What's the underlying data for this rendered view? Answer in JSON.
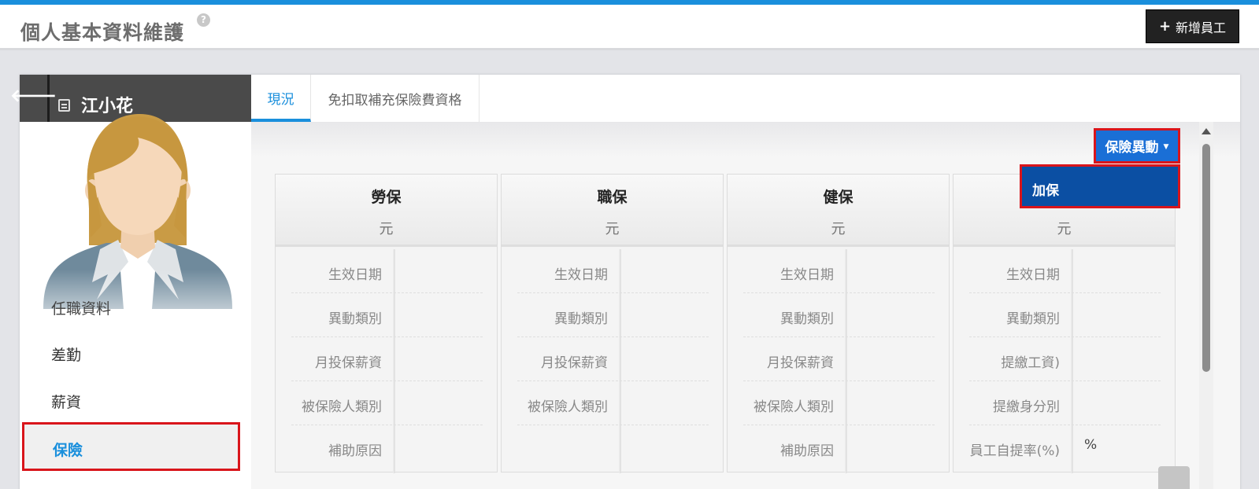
{
  "header": {
    "title": "個人基本資料維護",
    "help": "?",
    "add_button_plus": "+",
    "add_button_label": "新增員工"
  },
  "employee": {
    "name": "江小花"
  },
  "sidebar": {
    "items": [
      {
        "label": "任職資料"
      },
      {
        "label": "差勤"
      },
      {
        "label": "薪資"
      },
      {
        "label": "保險"
      }
    ]
  },
  "tabs": [
    {
      "label": "現況",
      "active": true
    },
    {
      "label": "免扣取補充保險費資格",
      "active": false
    }
  ],
  "actions": {
    "insurance_change_label": "保險異動",
    "menu_items": [
      {
        "label": "加保"
      }
    ]
  },
  "cards": [
    {
      "title": "勞保",
      "unit": "元",
      "rows": [
        {
          "label": "生效日期",
          "value": ""
        },
        {
          "label": "異動類別",
          "value": ""
        },
        {
          "label": "月投保薪資",
          "value": ""
        },
        {
          "label": "被保險人類別",
          "value": ""
        },
        {
          "label": "補助原因",
          "value": ""
        }
      ]
    },
    {
      "title": "職保",
      "unit": "元",
      "rows": [
        {
          "label": "生效日期",
          "value": ""
        },
        {
          "label": "異動類別",
          "value": ""
        },
        {
          "label": "月投保薪資",
          "value": ""
        },
        {
          "label": "被保險人類別",
          "value": ""
        },
        {
          "label": "",
          "value": ""
        }
      ]
    },
    {
      "title": "健保",
      "unit": "元",
      "rows": [
        {
          "label": "生效日期",
          "value": ""
        },
        {
          "label": "異動類別",
          "value": ""
        },
        {
          "label": "月投保薪資",
          "value": ""
        },
        {
          "label": "被保險人類別",
          "value": ""
        },
        {
          "label": "補助原因",
          "value": ""
        }
      ]
    },
    {
      "title": "",
      "unit": "元",
      "rows": [
        {
          "label": "生效日期",
          "value": ""
        },
        {
          "label": "異動類別",
          "value": ""
        },
        {
          "label": "提繳工資)",
          "value": ""
        },
        {
          "label": "提繳身分別",
          "value": ""
        },
        {
          "label": "員工自提率(%)",
          "value": "%"
        }
      ]
    }
  ],
  "colors": {
    "accent": "#1a8fdc",
    "highlight": "#d9151b",
    "button_blue": "#1a6fd6",
    "menu_blue": "#0b4fa3"
  }
}
